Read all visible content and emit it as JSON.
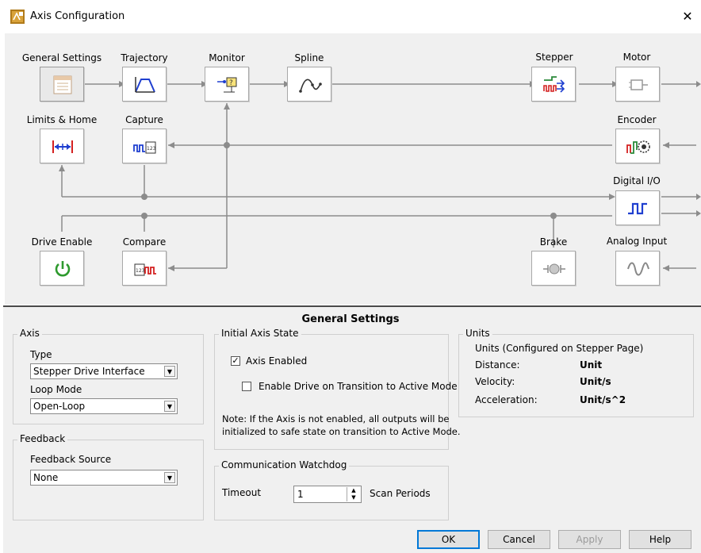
{
  "window": {
    "title": "Axis Configuration",
    "close": "✕"
  },
  "diagram": {
    "blocks": {
      "general_settings": "General Settings",
      "trajectory": "Trajectory",
      "monitor": "Monitor",
      "spline": "Spline",
      "stepper": "Stepper",
      "motor": "Motor",
      "limits_home": "Limits & Home",
      "capture": "Capture",
      "encoder": "Encoder",
      "digital_io": "Digital I/O",
      "drive_enable": "Drive Enable",
      "compare": "Compare",
      "brake": "Brake",
      "analog_input": "Analog Input"
    },
    "icons": {
      "general_settings": "settings-window-icon",
      "trajectory": "trajectory-profile-icon",
      "monitor": "monitor-icon",
      "spline": "spline-curve-icon",
      "stepper": "stepper-signal-icon",
      "motor": "motor-icon",
      "limits_home": "limits-arrows-icon",
      "capture": "capture-pulse-icon",
      "encoder": "encoder-icon",
      "digital_io": "square-wave-icon",
      "drive_enable": "power-icon",
      "compare": "compare-pulse-icon",
      "brake": "brake-icon",
      "analog_input": "sine-wave-icon"
    },
    "colors": {
      "power": "#2e9a2e",
      "blue": "#1f3fd0",
      "red": "#d42020",
      "green": "#2a8a3a"
    }
  },
  "panel": {
    "title": "General Settings",
    "axis": {
      "legend": "Axis",
      "type_label": "Type",
      "type_value": "Stepper Drive Interface",
      "loop_label": "Loop Mode",
      "loop_value": "Open-Loop"
    },
    "feedback": {
      "legend": "Feedback",
      "source_label": "Feedback Source",
      "source_value": "None"
    },
    "initial_state": {
      "legend": "Initial Axis State",
      "axis_enabled_label": "Axis Enabled",
      "axis_enabled_checked": true,
      "enable_drive_label": "Enable Drive on Transition to Active Mode",
      "enable_drive_checked": false,
      "note_line1": "Note: If the Axis is not enabled, all outputs will be",
      "note_line2": "initialized to safe state on transition to Active Mode."
    },
    "watchdog": {
      "legend": "Communication Watchdog",
      "timeout_label": "Timeout",
      "timeout_value": "1",
      "unit_label": "Scan Periods"
    },
    "units": {
      "legend": "Units",
      "header": "Units (Configured on Stepper Page)",
      "rows": [
        {
          "label": "Distance:",
          "value": "Unit"
        },
        {
          "label": "Velocity:",
          "value": "Unit/s"
        },
        {
          "label": "Acceleration:",
          "value": "Unit/s^2"
        }
      ]
    }
  },
  "buttons": {
    "ok": "OK",
    "cancel": "Cancel",
    "apply": "Apply",
    "help": "Help"
  }
}
